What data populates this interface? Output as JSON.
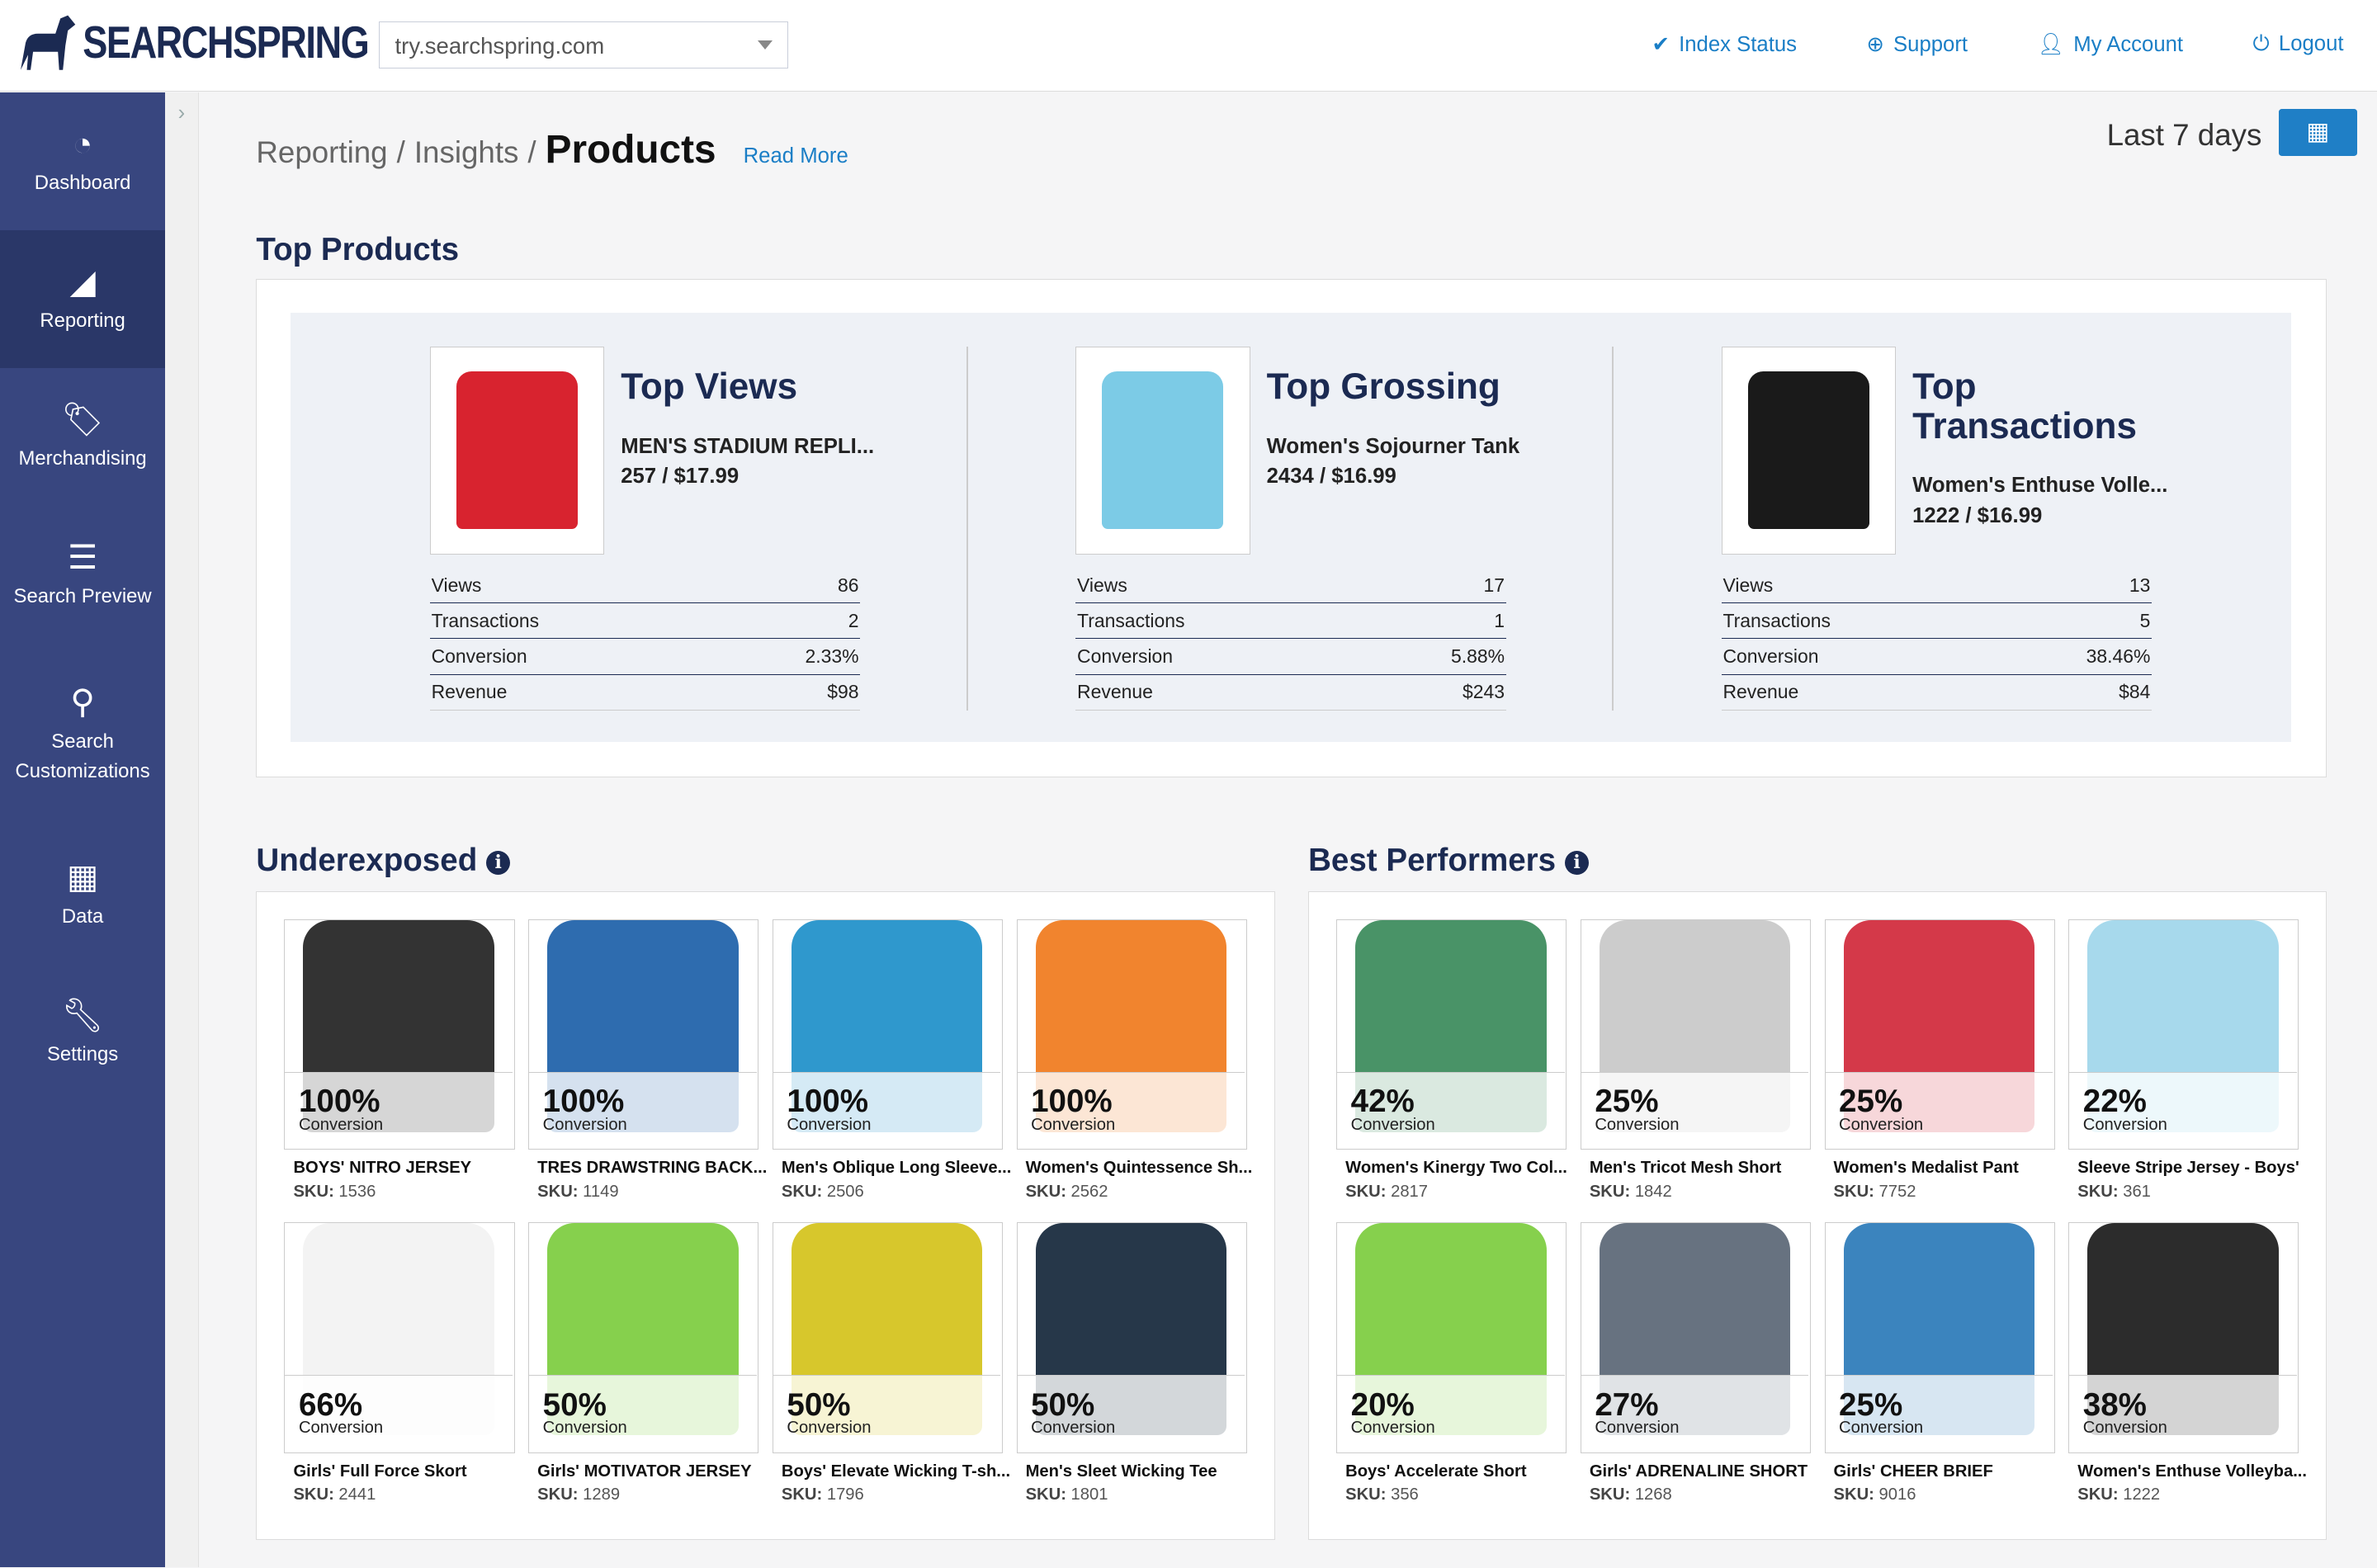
{
  "header": {
    "brand": "SEARCHSPRING",
    "site": "try.searchspring.com",
    "links": [
      {
        "icon": "check-circle-icon",
        "label": "Index Status"
      },
      {
        "icon": "lifebuoy-icon",
        "label": "Support"
      },
      {
        "icon": "user-icon",
        "label": "My Account"
      },
      {
        "icon": "power-icon",
        "label": "Logout"
      }
    ]
  },
  "sidebar": {
    "items": [
      {
        "icon": "dashboard-icon",
        "label": "Dashboard"
      },
      {
        "icon": "chart-area-icon",
        "label": "Reporting",
        "active": true
      },
      {
        "icon": "tags-icon",
        "label": "Merchandising"
      },
      {
        "icon": "list-icon",
        "label": "Search Preview"
      },
      {
        "icon": "search-icon",
        "label": "Search Customizations"
      },
      {
        "icon": "grid-icon",
        "label": "Data"
      },
      {
        "icon": "wrench-icon",
        "label": "Settings"
      }
    ]
  },
  "breadcrumb": {
    "part1": "Reporting",
    "sep": "/",
    "part2": "Insights",
    "current": "Products",
    "read_more": "Read More"
  },
  "date_range": "Last 7 days",
  "top_products": {
    "title": "Top Products",
    "items": [
      {
        "title": "Top Views",
        "name": "MEN'S STADIUM REPLI...",
        "stats": "257 / $17.99",
        "color": "#d8232f",
        "rows": [
          [
            "Views",
            "86"
          ],
          [
            "Transactions",
            "2"
          ],
          [
            "Conversion",
            "2.33%"
          ],
          [
            "Revenue",
            "$98"
          ]
        ]
      },
      {
        "title": "Top Grossing",
        "name": "Women's Sojourner Tank",
        "stats": "2434 / $16.99",
        "color": "#7ccbe6",
        "rows": [
          [
            "Views",
            "17"
          ],
          [
            "Transactions",
            "1"
          ],
          [
            "Conversion",
            "5.88%"
          ],
          [
            "Revenue",
            "$243"
          ]
        ]
      },
      {
        "title": "Top Transactions",
        "name": "Women's Enthuse Volle...",
        "stats": "1222 / $16.99",
        "color": "#1a1a1a",
        "rows": [
          [
            "Views",
            "13"
          ],
          [
            "Transactions",
            "5"
          ],
          [
            "Conversion",
            "38.46%"
          ],
          [
            "Revenue",
            "$84"
          ]
        ]
      }
    ]
  },
  "underexposed": {
    "title": "Underexposed",
    "items": [
      {
        "pct": "100%",
        "label": "Conversion",
        "name": "BOYS' NITRO JERSEY",
        "sku_label": "SKU:",
        "sku": "1536",
        "color": "#222"
      },
      {
        "pct": "100%",
        "label": "Conversion",
        "name": "TRES DRAWSTRING BACK...",
        "sku_label": "SKU:",
        "sku": "1149",
        "color": "#1c5fa8"
      },
      {
        "pct": "100%",
        "label": "Conversion",
        "name": "Men's Oblique Long Sleeve...",
        "sku_label": "SKU:",
        "sku": "2506",
        "color": "#1d8fc9"
      },
      {
        "pct": "100%",
        "label": "Conversion",
        "name": "Women's Quintessence Sh...",
        "sku_label": "SKU:",
        "sku": "2562",
        "color": "#f07a1c"
      },
      {
        "pct": "66%",
        "label": "Conversion",
        "name": "Girls' Full Force Skort",
        "sku_label": "SKU:",
        "sku": "2441",
        "color": "#f2f2f2"
      },
      {
        "pct": "50%",
        "label": "Conversion",
        "name": "Girls' MOTIVATOR JERSEY",
        "sku_label": "SKU:",
        "sku": "1289",
        "color": "#7ccc3e"
      },
      {
        "pct": "50%",
        "label": "Conversion",
        "name": "Boys' Elevate Wicking T-sh...",
        "sku_label": "SKU:",
        "sku": "1796",
        "color": "#d4c21a"
      },
      {
        "pct": "50%",
        "label": "Conversion",
        "name": "Men's Sleet Wicking Tee",
        "sku_label": "SKU:",
        "sku": "1801",
        "color": "#13263a"
      }
    ]
  },
  "best_performers": {
    "title": "Best Performers",
    "items": [
      {
        "pct": "42%",
        "label": "Conversion",
        "name": "Women's Kinergy Two Col...",
        "sku_label": "SKU:",
        "sku": "2817",
        "color": "#3a8a5a"
      },
      {
        "pct": "25%",
        "label": "Conversion",
        "name": "Men's Tricot Mesh Short",
        "sku_label": "SKU:",
        "sku": "1842",
        "color": "#c8c8c8"
      },
      {
        "pct": "25%",
        "label": "Conversion",
        "name": "Women's Medalist Pant",
        "sku_label": "SKU:",
        "sku": "7752",
        "color": "#d0283a"
      },
      {
        "pct": "22%",
        "label": "Conversion",
        "name": "Sleeve Stripe Jersey - Boys'",
        "sku_label": "SKU:",
        "sku": "361",
        "color": "#9fd6ea"
      },
      {
        "pct": "20%",
        "label": "Conversion",
        "name": "Boys' Accelerate Short",
        "sku_label": "SKU:",
        "sku": "356",
        "color": "#7ccc3e"
      },
      {
        "pct": "27%",
        "label": "Conversion",
        "name": "Girls' ADRENALINE SHORT",
        "sku_label": "SKU:",
        "sku": "1268",
        "color": "#5a6675"
      },
      {
        "pct": "25%",
        "label": "Conversion",
        "name": "Girls' CHEER BRIEF",
        "sku_label": "SKU:",
        "sku": "9016",
        "color": "#2a7ab8"
      },
      {
        "pct": "38%",
        "label": "Conversion",
        "name": "Women's Enthuse Volleyba...",
        "sku_label": "SKU:",
        "sku": "1222",
        "color": "#1a1a1a"
      }
    ]
  }
}
